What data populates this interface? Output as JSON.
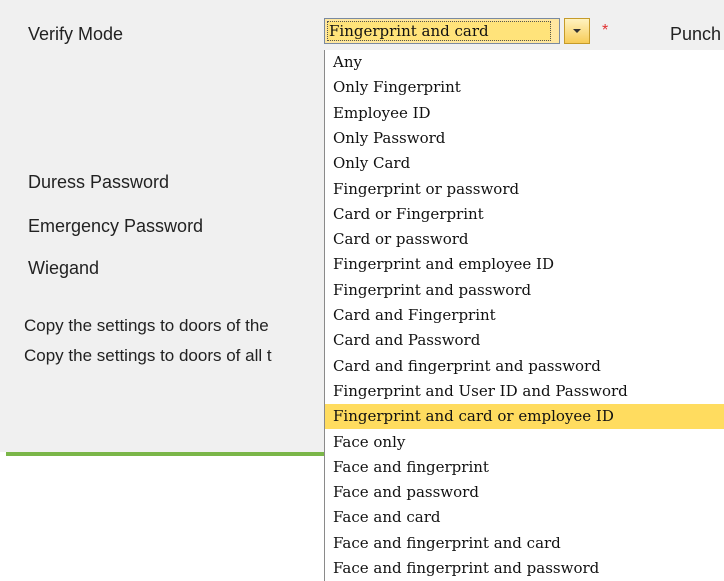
{
  "form": {
    "verify_mode_label": "Verify Mode",
    "punch_label": "Punch",
    "duress_password_label": "Duress Password",
    "emergency_password_label": "Emergency Password",
    "wiegand_label": "Wiegand",
    "copy_doors_label_1": "Copy the settings to doors of the",
    "copy_doors_label_2": "Copy the settings to doors of all t",
    "required_marker": "*"
  },
  "verify_mode_select": {
    "selected_value": "Fingerprint and card",
    "highlighted_index": 14,
    "options": [
      "Any",
      "Only Fingerprint",
      "Employee ID",
      "Only Password",
      "Only Card",
      "Fingerprint or password",
      "Card or Fingerprint",
      "Card or password",
      "Fingerprint and employee ID",
      "Fingerprint and password",
      "Card and Fingerprint",
      "Card and Password",
      "Card and fingerprint and password",
      "Fingerprint and User ID and Password",
      "Fingerprint and card or employee ID",
      "Face only",
      "Face and fingerprint",
      "Face and password",
      "Face and card",
      "Face and fingerprint and card",
      "Face and fingerprint and password"
    ]
  },
  "colors": {
    "panel_bg": "#f0f0f0",
    "accent_border": "#7ab648",
    "highlight": "#ffdc5f",
    "required": "#e03030"
  },
  "icons": {
    "dropdown": "chevron-down-icon"
  }
}
